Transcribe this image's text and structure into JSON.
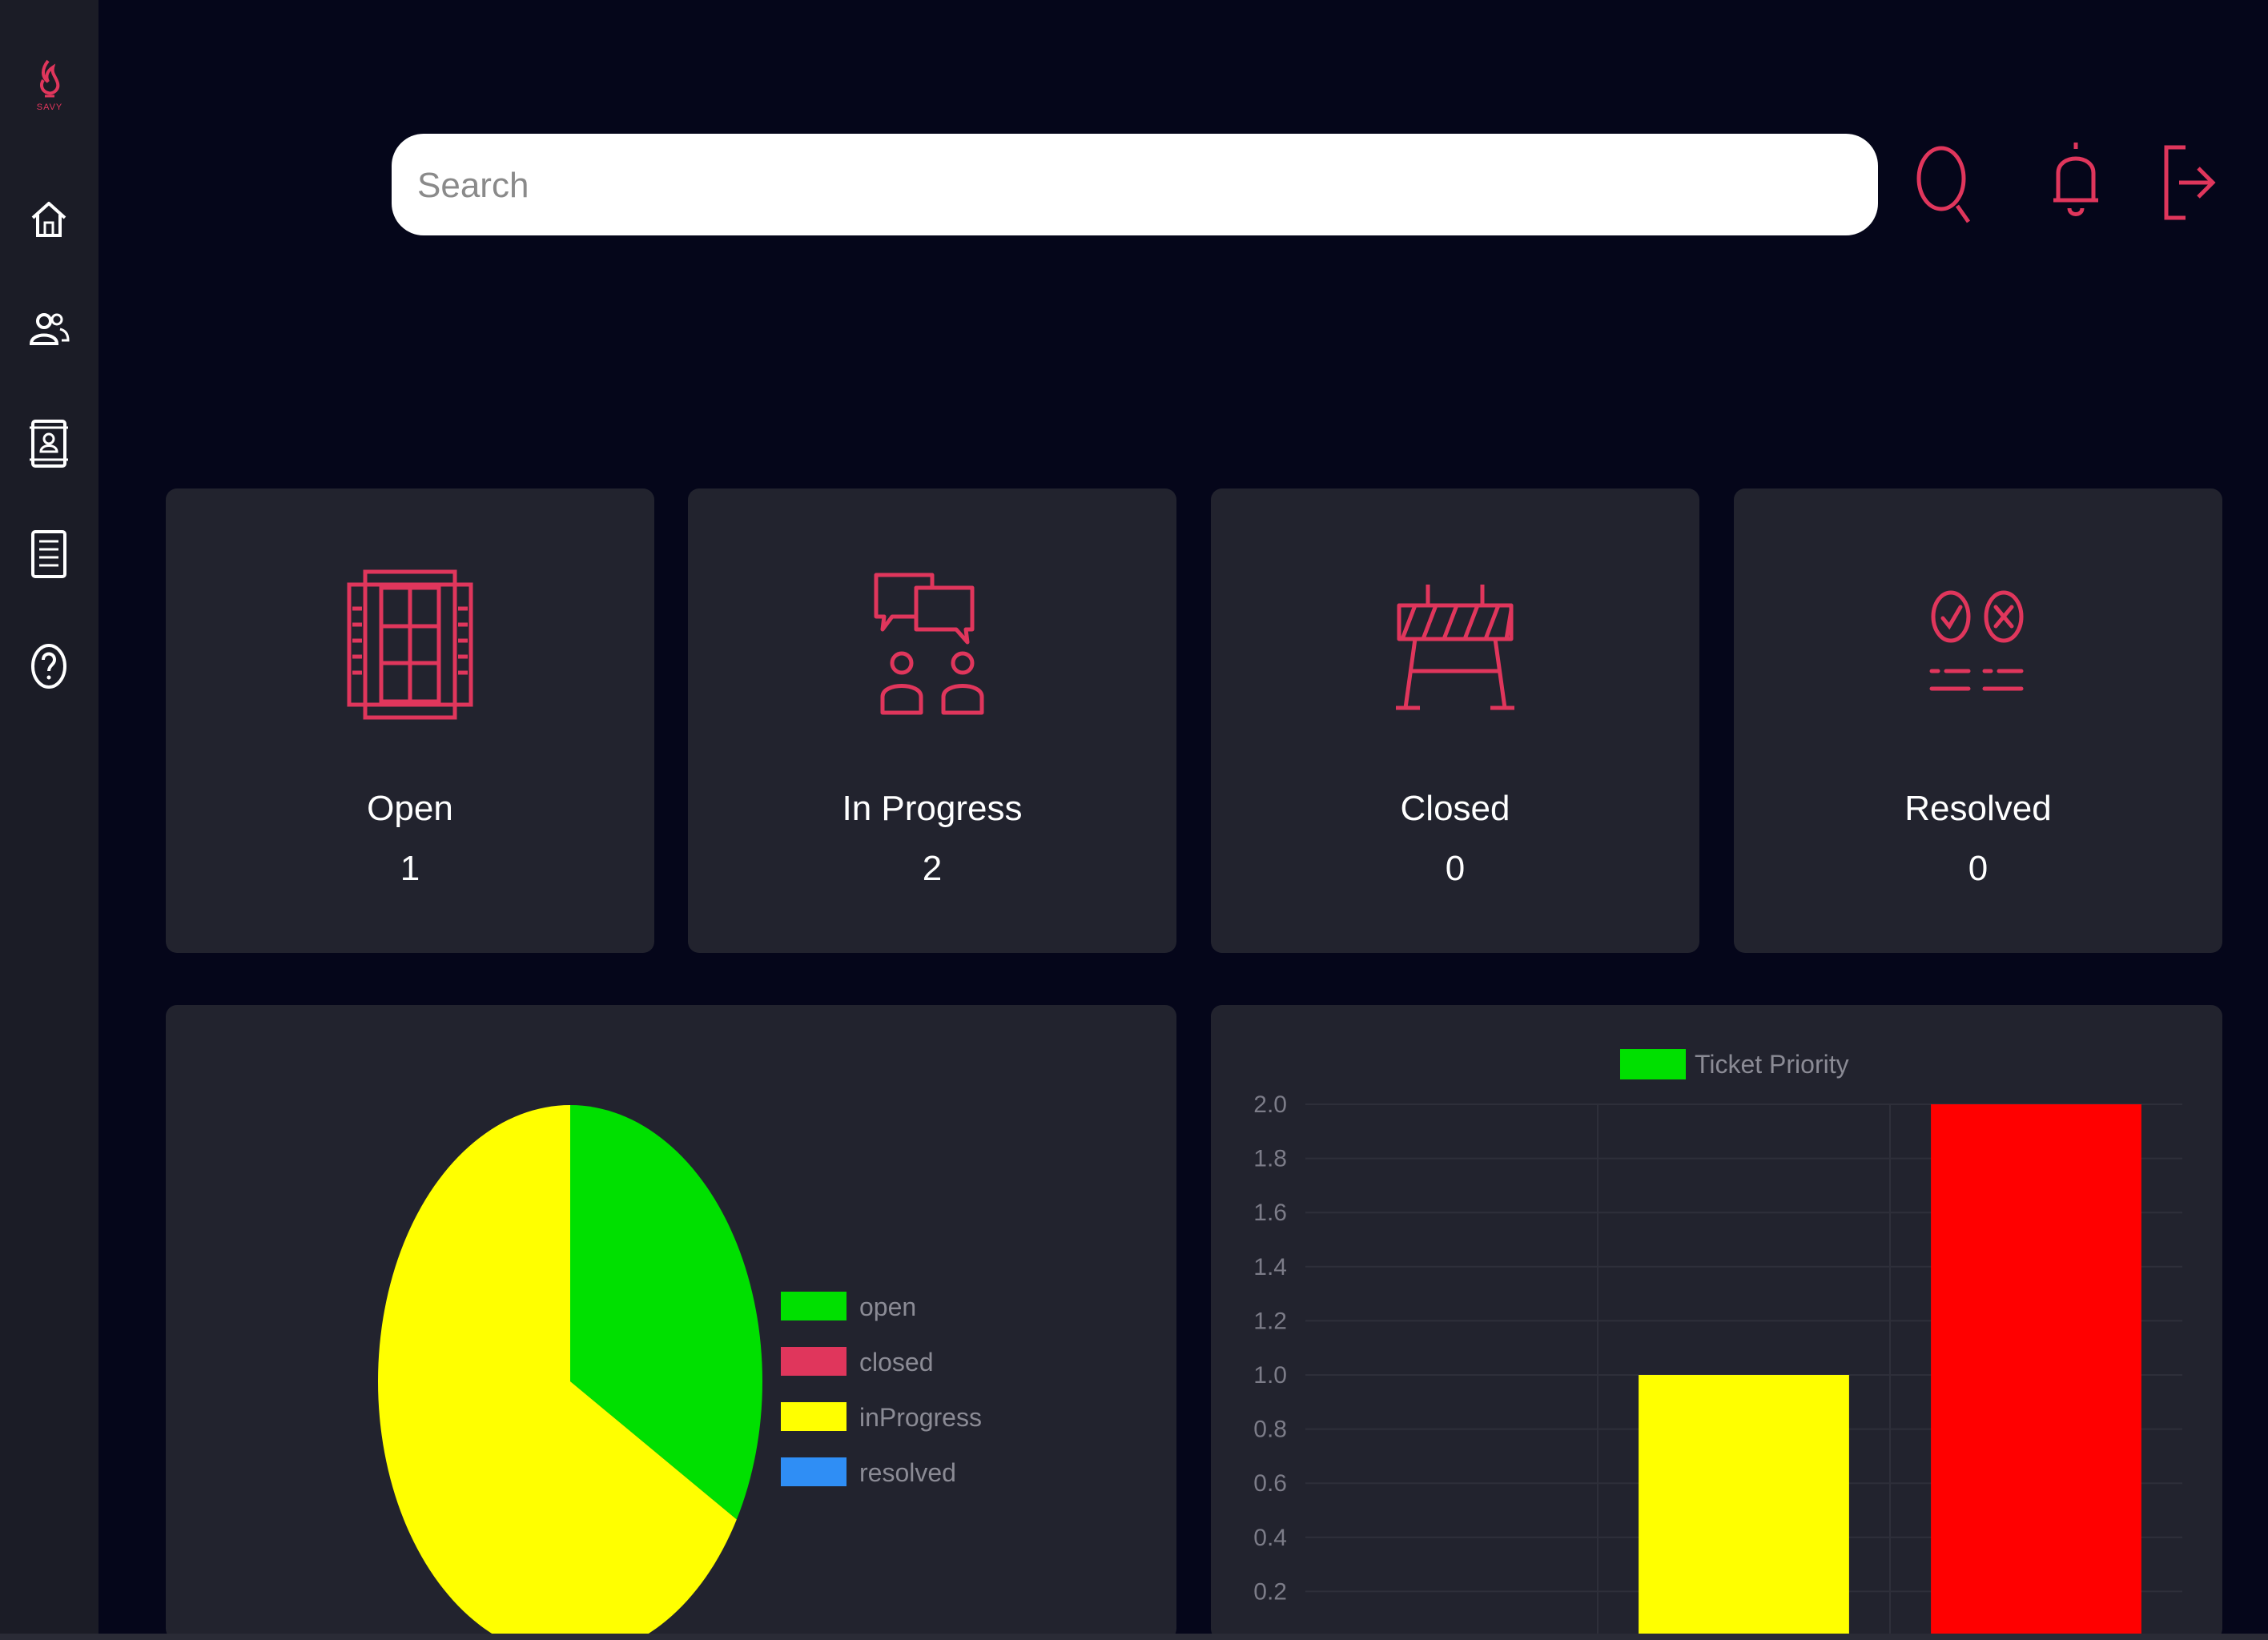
{
  "brand": {
    "logo_text": "SAVY",
    "accent_color": "#e0365c"
  },
  "sidebar": {
    "items": [
      {
        "icon": "home-icon"
      },
      {
        "icon": "users-icon"
      },
      {
        "icon": "contact-book-icon"
      },
      {
        "icon": "list-icon"
      },
      {
        "icon": "help-icon"
      }
    ]
  },
  "header": {
    "search": {
      "placeholder": "Search",
      "value": ""
    },
    "icons": [
      "search-icon",
      "bell-icon",
      "logout-icon"
    ]
  },
  "cards": [
    {
      "label": "Open",
      "value": "1",
      "icon": "window-icon"
    },
    {
      "label": "In Progress",
      "value": "2",
      "icon": "discussion-icon"
    },
    {
      "label": "Closed",
      "value": "0",
      "icon": "barrier-icon"
    },
    {
      "label": "Resolved",
      "value": "0",
      "icon": "check-cross-list-icon"
    }
  ],
  "chart_data": [
    {
      "type": "pie",
      "labels": [
        "open",
        "closed",
        "inProgress",
        "resolved"
      ],
      "values": [
        1,
        0,
        2,
        0
      ],
      "colors": [
        "#00e000",
        "#e0365c",
        "#ffff00",
        "#2f8ef5"
      ],
      "legend": "right"
    },
    {
      "type": "bar",
      "categories": [
        "",
        "",
        ""
      ],
      "series": [
        {
          "name": "Ticket Priority",
          "values": [
            0,
            1,
            2
          ]
        }
      ],
      "bar_colors": [
        "#00e000",
        "#ffff00",
        "#ff0000"
      ],
      "legend_color": "#00e000",
      "ylim": [
        0,
        2
      ],
      "yticks": [
        "2.0",
        "1.8",
        "1.6",
        "1.4",
        "1.2",
        "1.0",
        "0.8",
        "0.6",
        "0.4",
        "0.2"
      ],
      "grid": true,
      "legend": "top"
    }
  ]
}
